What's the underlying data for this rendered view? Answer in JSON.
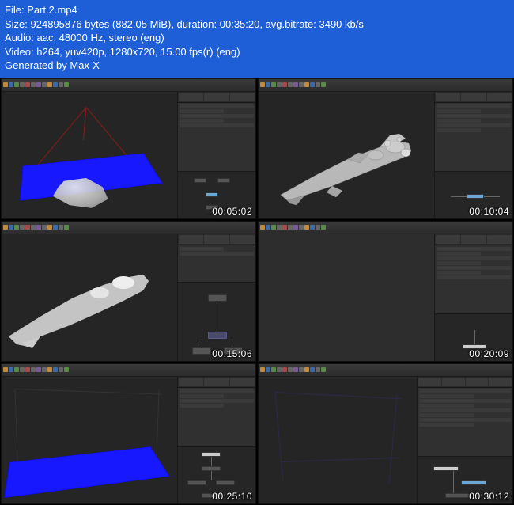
{
  "header": {
    "file_label": "File:",
    "file_value": "Part.2.mp4",
    "size_label": "Size:",
    "size_value": "924895876 bytes (882.05 MiB), duration: 00:35:20, avg.bitrate: 3490 kb/s",
    "audio_label": "Audio:",
    "audio_value": "aac, 48000 Hz, stereo (eng)",
    "video_label": "Video:",
    "video_value": "h264, yuv420p, 1280x720, 15.00 fps(r) (eng)",
    "generated": "Generated by Max-X"
  },
  "thumbs": [
    {
      "timestamp": "00:05:02"
    },
    {
      "timestamp": "00:10:04"
    },
    {
      "timestamp": "00:15:06"
    },
    {
      "timestamp": "00:20:09"
    },
    {
      "timestamp": "00:25:10"
    },
    {
      "timestamp": "00:30:12"
    }
  ]
}
